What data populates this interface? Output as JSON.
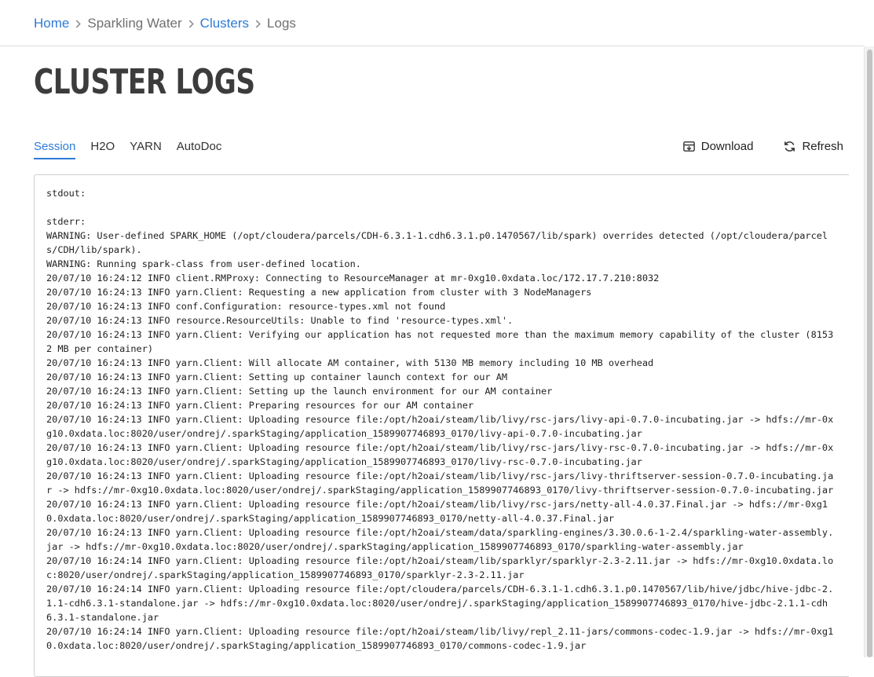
{
  "breadcrumb": {
    "items": [
      {
        "label": "Home"
      },
      {
        "label": "Sparkling Water"
      },
      {
        "label": "Clusters"
      },
      {
        "label": "Logs"
      }
    ]
  },
  "page": {
    "title": "CLUSTER LOGS"
  },
  "tabs": [
    {
      "label": "Session",
      "active": true
    },
    {
      "label": "H2O"
    },
    {
      "label": "YARN"
    },
    {
      "label": "AutoDoc"
    }
  ],
  "actions": {
    "download_label": "Download",
    "refresh_label": "Refresh"
  },
  "colors": {
    "accent": "#2d7bd7",
    "title": "#3c3c3c"
  },
  "icons": {
    "separator": "chevron-right-icon",
    "download": "download-icon",
    "refresh": "refresh-icon"
  },
  "log": {
    "text": "stdout:\n\nstderr:\nWARNING: User-defined SPARK_HOME (/opt/cloudera/parcels/CDH-6.3.1-1.cdh6.3.1.p0.1470567/lib/spark) overrides detected (/opt/cloudera/parcels/CDH/lib/spark).\nWARNING: Running spark-class from user-defined location.\n20/07/10 16:24:12 INFO client.RMProxy: Connecting to ResourceManager at mr-0xg10.0xdata.loc/172.17.7.210:8032\n20/07/10 16:24:13 INFO yarn.Client: Requesting a new application from cluster with 3 NodeManagers\n20/07/10 16:24:13 INFO conf.Configuration: resource-types.xml not found\n20/07/10 16:24:13 INFO resource.ResourceUtils: Unable to find 'resource-types.xml'.\n20/07/10 16:24:13 INFO yarn.Client: Verifying our application has not requested more than the maximum memory capability of the cluster (81532 MB per container)\n20/07/10 16:24:13 INFO yarn.Client: Will allocate AM container, with 5130 MB memory including 10 MB overhead\n20/07/10 16:24:13 INFO yarn.Client: Setting up container launch context for our AM\n20/07/10 16:24:13 INFO yarn.Client: Setting up the launch environment for our AM container\n20/07/10 16:24:13 INFO yarn.Client: Preparing resources for our AM container\n20/07/10 16:24:13 INFO yarn.Client: Uploading resource file:/opt/h2oai/steam/lib/livy/rsc-jars/livy-api-0.7.0-incubating.jar -> hdfs://mr-0xg10.0xdata.loc:8020/user/ondrej/.sparkStaging/application_1589907746893_0170/livy-api-0.7.0-incubating.jar\n20/07/10 16:24:13 INFO yarn.Client: Uploading resource file:/opt/h2oai/steam/lib/livy/rsc-jars/livy-rsc-0.7.0-incubating.jar -> hdfs://mr-0xg10.0xdata.loc:8020/user/ondrej/.sparkStaging/application_1589907746893_0170/livy-rsc-0.7.0-incubating.jar\n20/07/10 16:24:13 INFO yarn.Client: Uploading resource file:/opt/h2oai/steam/lib/livy/rsc-jars/livy-thriftserver-session-0.7.0-incubating.jar -> hdfs://mr-0xg10.0xdata.loc:8020/user/ondrej/.sparkStaging/application_1589907746893_0170/livy-thriftserver-session-0.7.0-incubating.jar\n20/07/10 16:24:13 INFO yarn.Client: Uploading resource file:/opt/h2oai/steam/lib/livy/rsc-jars/netty-all-4.0.37.Final.jar -> hdfs://mr-0xg10.0xdata.loc:8020/user/ondrej/.sparkStaging/application_1589907746893_0170/netty-all-4.0.37.Final.jar\n20/07/10 16:24:13 INFO yarn.Client: Uploading resource file:/opt/h2oai/steam/data/sparkling-engines/3.30.0.6-1-2.4/sparkling-water-assembly.jar -> hdfs://mr-0xg10.0xdata.loc:8020/user/ondrej/.sparkStaging/application_1589907746893_0170/sparkling-water-assembly.jar\n20/07/10 16:24:14 INFO yarn.Client: Uploading resource file:/opt/h2oai/steam/lib/sparklyr/sparklyr-2.3-2.11.jar -> hdfs://mr-0xg10.0xdata.loc:8020/user/ondrej/.sparkStaging/application_1589907746893_0170/sparklyr-2.3-2.11.jar\n20/07/10 16:24:14 INFO yarn.Client: Uploading resource file:/opt/cloudera/parcels/CDH-6.3.1-1.cdh6.3.1.p0.1470567/lib/hive/jdbc/hive-jdbc-2.1.1-cdh6.3.1-standalone.jar -> hdfs://mr-0xg10.0xdata.loc:8020/user/ondrej/.sparkStaging/application_1589907746893_0170/hive-jdbc-2.1.1-cdh6.3.1-standalone.jar\n20/07/10 16:24:14 INFO yarn.Client: Uploading resource file:/opt/h2oai/steam/lib/livy/repl_2.11-jars/commons-codec-1.9.jar -> hdfs://mr-0xg10.0xdata.loc:8020/user/ondrej/.sparkStaging/application_1589907746893_0170/commons-codec-1.9.jar"
  }
}
